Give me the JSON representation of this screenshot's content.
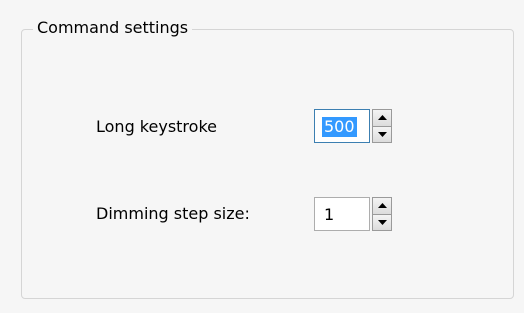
{
  "group": {
    "title": "Command settings"
  },
  "long_keystroke": {
    "label": "Long keystroke",
    "value": "500"
  },
  "dimming_step": {
    "label": "Dimming step size:",
    "value": "1"
  },
  "icons": {
    "up": "arrow-up-icon",
    "down": "arrow-down-icon"
  },
  "colors": {
    "selection": "#3399ff",
    "focus_border": "#3c7fb1",
    "group_border": "#d5d5d5"
  }
}
